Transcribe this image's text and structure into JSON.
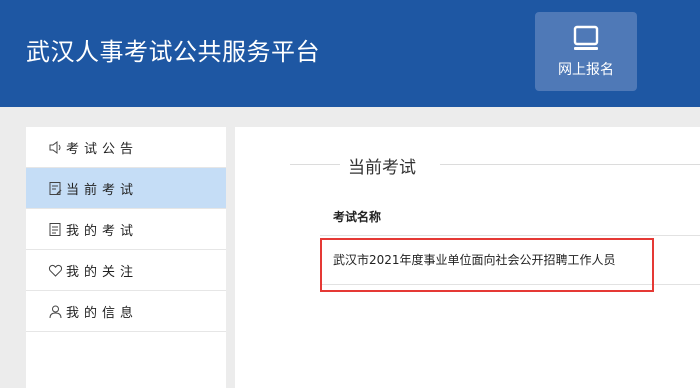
{
  "header": {
    "site_title": "武汉人事考试公共服务平台",
    "register_button": {
      "label": "网上报名",
      "icon": "monitor-icon"
    }
  },
  "sidebar": {
    "items": [
      {
        "label": "考试公告",
        "icon": "speaker-icon",
        "active": false
      },
      {
        "label": "当前考试",
        "icon": "document-edit-icon",
        "active": true
      },
      {
        "label": "我的考试",
        "icon": "document-list-icon",
        "active": false
      },
      {
        "label": "我的关注",
        "icon": "heart-icon",
        "active": false
      },
      {
        "label": "我的信息",
        "icon": "user-icon",
        "active": false
      }
    ]
  },
  "main": {
    "section_title": "当前考试",
    "table": {
      "column_header": "考试名称",
      "rows": [
        {
          "exam_name": "武汉市2021年度事业单位面向社会公开招聘工作人员"
        }
      ]
    }
  },
  "colors": {
    "header_bg": "#1e57a3",
    "button_bg": "#4f79b7",
    "active_item_bg": "#c5ddf6",
    "highlight_border": "#e53935"
  }
}
